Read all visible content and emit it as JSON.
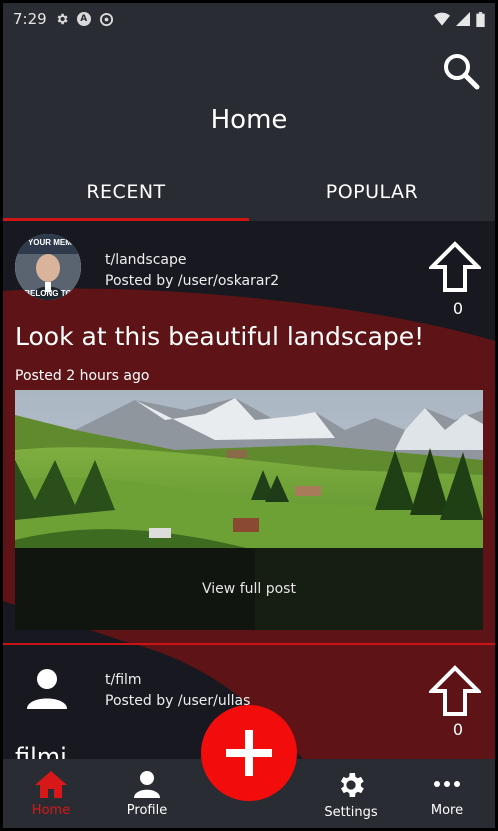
{
  "status_bar": {
    "time": "7:29"
  },
  "header": {
    "title": "Home"
  },
  "tabs": [
    {
      "label": "RECENT",
      "active": true
    },
    {
      "label": "POPULAR",
      "active": false
    }
  ],
  "posts": [
    {
      "subreddit": "t/landscape",
      "posted_by": "Posted by /user/oskarar2",
      "votes": "0",
      "title": "Look at this beautiful landscape!",
      "time": "Posted 2 hours ago",
      "view_label": "View full post",
      "avatar_text_top": "IF YOUR MEME",
      "avatar_text_bottom": "BELONG TO"
    },
    {
      "subreddit": "t/film",
      "posted_by": "Posted by /user/ullas",
      "votes": "0",
      "title": "filmi"
    }
  ],
  "bottom_nav": [
    {
      "label": "Home",
      "icon": "home-icon",
      "active": true
    },
    {
      "label": "Profile",
      "icon": "person-icon",
      "active": false
    },
    {
      "label": "Settings",
      "icon": "gear-icon",
      "active": false
    },
    {
      "label": "More",
      "icon": "more-dots-icon",
      "active": false
    }
  ],
  "colors": {
    "accent": "#d01515",
    "fab": "#f20c0c",
    "surface": "#2a2c33",
    "background": "#181920"
  }
}
